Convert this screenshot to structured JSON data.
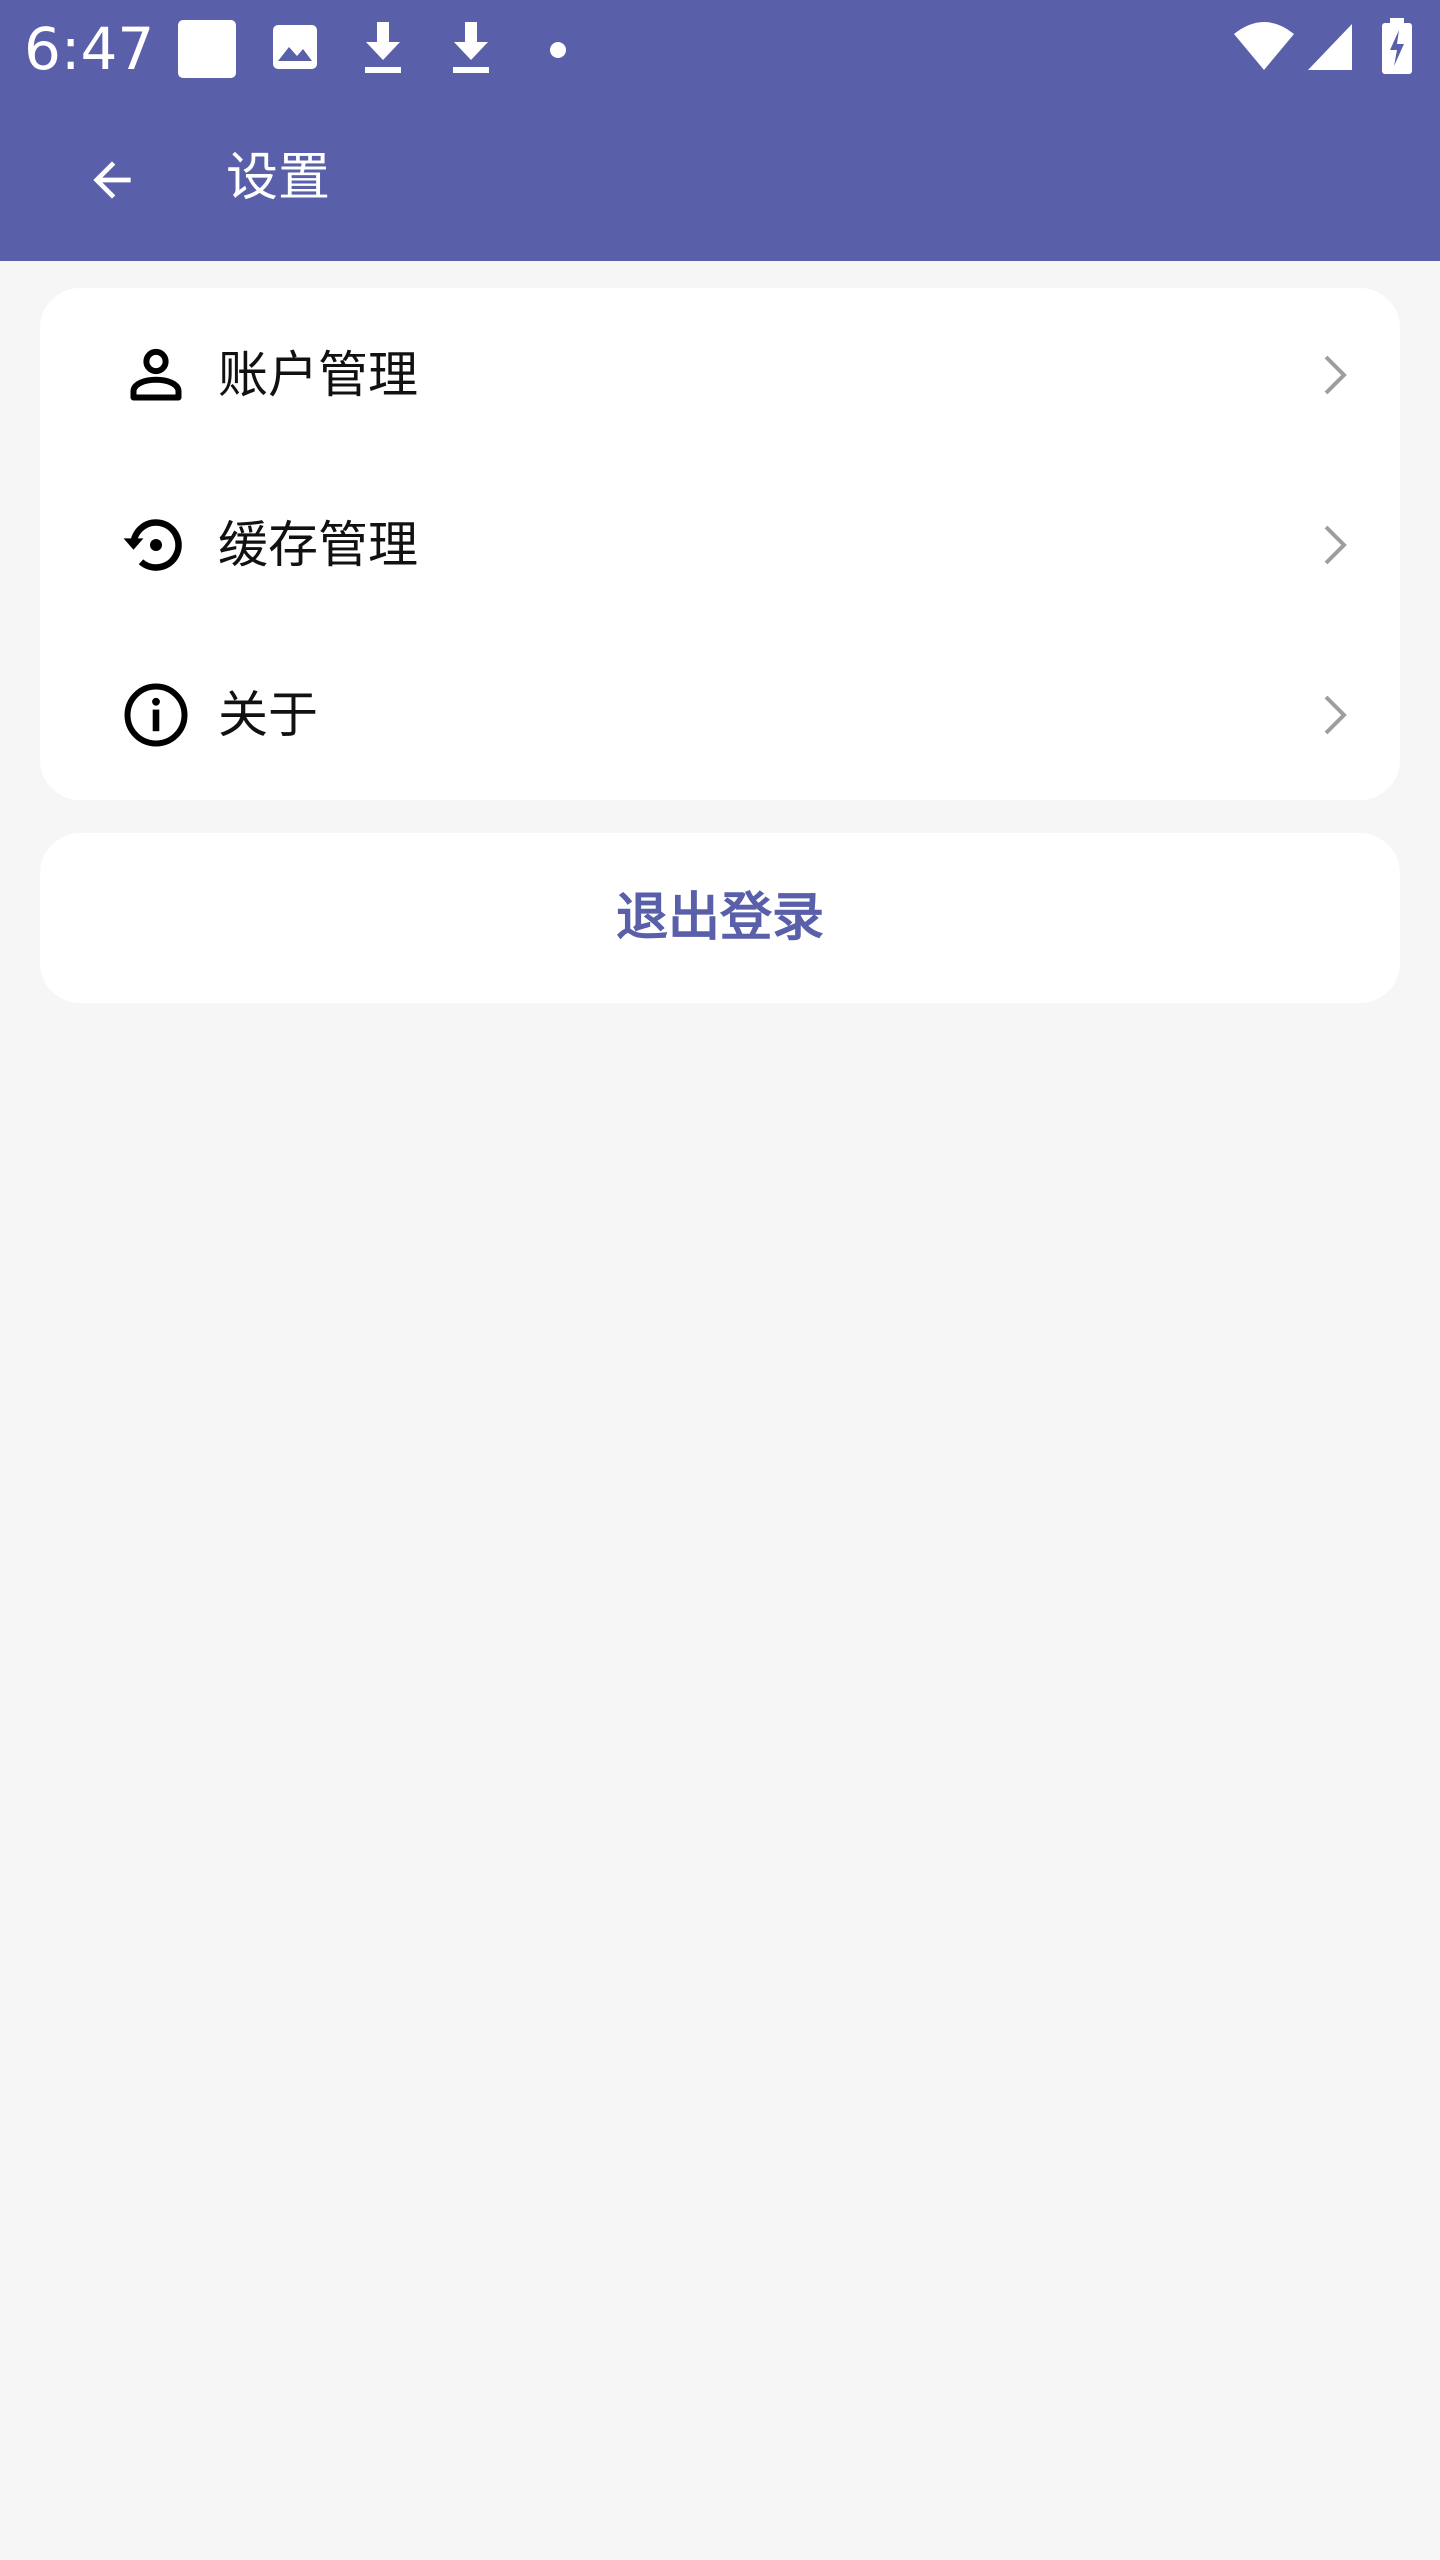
{
  "status_bar": {
    "time": "6:47",
    "left_icons": [
      "square-notification-icon",
      "image-icon",
      "download-icon",
      "download-icon",
      "dot-icon"
    ],
    "right_icons": [
      "wifi-icon",
      "cellular-signal-icon",
      "battery-charging-icon"
    ]
  },
  "app_bar": {
    "title": "设置",
    "back_icon": "arrow-back-icon"
  },
  "menu": {
    "items": [
      {
        "label": "账户管理",
        "icon": "person-icon"
      },
      {
        "label": "缓存管理",
        "icon": "restore-icon"
      },
      {
        "label": "关于",
        "icon": "info-icon"
      }
    ]
  },
  "logout": {
    "label": "退出登录"
  },
  "colors": {
    "primary": "#5a5faa",
    "background": "#f6f6f6",
    "card": "#ffffff",
    "text": "#111111",
    "chevron": "#9e9e9e"
  }
}
